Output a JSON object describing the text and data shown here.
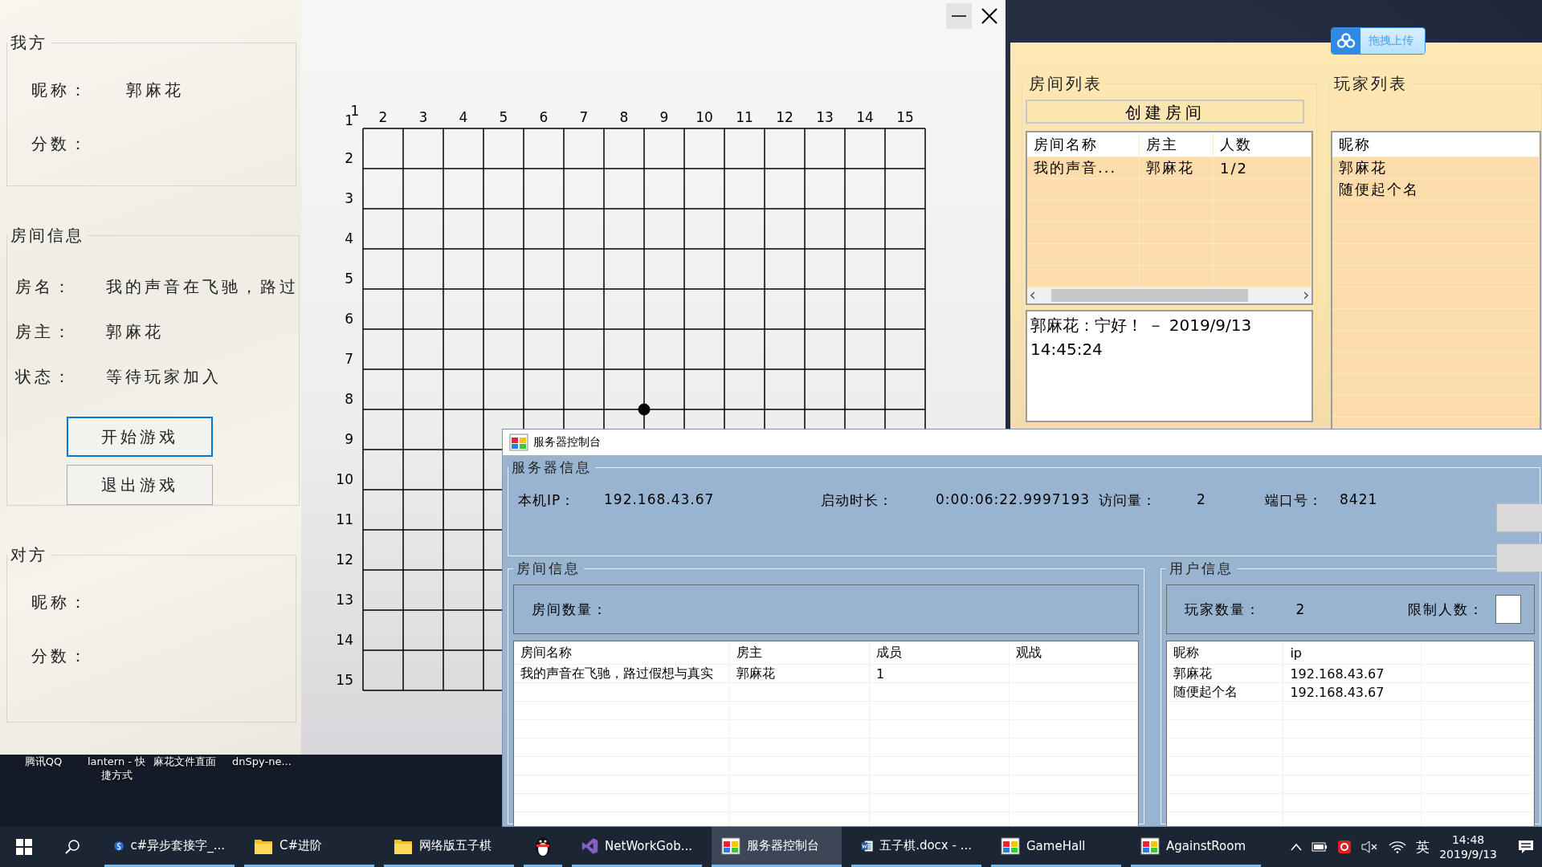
{
  "desktop_icons": [
    {
      "lines": [
        "腾讯QQ"
      ]
    },
    {
      "lines": [
        "lantern - 快",
        "捷方式"
      ]
    },
    {
      "lines": [
        "麻花文件直面"
      ]
    },
    {
      "lines": [
        "dnSpy-ne..."
      ]
    }
  ],
  "game_window": {
    "groups": [
      {
        "title": "我方",
        "fields": [
          {
            "label": "昵称：",
            "value": "郭麻花"
          },
          {
            "label": "分数："
          }
        ]
      },
      {
        "title": "房间信息",
        "fields": [
          {
            "label": "房名：",
            "value": "我的声音在飞驰，路过"
          },
          {
            "label": "房主：",
            "value": "郭麻花"
          },
          {
            "label": "状态：",
            "value": "等待玩家加入"
          }
        ],
        "buttons": [
          {
            "label": "开始游戏",
            "focused": true
          },
          {
            "label": "退出游戏",
            "focused": false
          }
        ]
      },
      {
        "title": "对方",
        "fields": [
          {
            "label": "昵称："
          },
          {
            "label": "分数："
          }
        ]
      }
    ],
    "board": {
      "column_labels": [
        "1",
        "2",
        "3",
        "4",
        "5",
        "6",
        "7",
        "8",
        "9",
        "10",
        "11",
        "12",
        "13",
        "14",
        "15"
      ],
      "rows": [
        {
          "label": "1",
          "points": [
            {
              "stone": false
            },
            {
              "stone": false
            },
            {
              "stone": false
            },
            {
              "stone": false
            },
            {
              "stone": false
            },
            {
              "stone": false
            },
            {
              "stone": false
            },
            {
              "stone": false
            },
            {
              "stone": false
            },
            {
              "stone": false
            },
            {
              "stone": false
            },
            {
              "stone": false
            },
            {
              "stone": false
            },
            {
              "stone": false
            },
            {
              "stone": false
            }
          ]
        },
        {
          "label": "2",
          "points": [
            {
              "stone": false
            },
            {
              "stone": false
            },
            {
              "stone": false
            },
            {
              "stone": false
            },
            {
              "stone": false
            },
            {
              "stone": false
            },
            {
              "stone": false
            },
            {
              "stone": false
            },
            {
              "stone": false
            },
            {
              "stone": false
            },
            {
              "stone": false
            },
            {
              "stone": false
            },
            {
              "stone": false
            },
            {
              "stone": false
            },
            {
              "stone": false
            }
          ]
        },
        {
          "label": "3",
          "points": [
            {
              "stone": false
            },
            {
              "stone": false
            },
            {
              "stone": false
            },
            {
              "stone": false
            },
            {
              "stone": false
            },
            {
              "stone": false
            },
            {
              "stone": false
            },
            {
              "stone": false
            },
            {
              "stone": false
            },
            {
              "stone": false
            },
            {
              "stone": false
            },
            {
              "stone": false
            },
            {
              "stone": false
            },
            {
              "stone": false
            },
            {
              "stone": false
            }
          ]
        },
        {
          "label": "4",
          "points": [
            {
              "stone": false
            },
            {
              "stone": false
            },
            {
              "stone": false
            },
            {
              "stone": false
            },
            {
              "stone": false
            },
            {
              "stone": false
            },
            {
              "stone": false
            },
            {
              "stone": false
            },
            {
              "stone": false
            },
            {
              "stone": false
            },
            {
              "stone": false
            },
            {
              "stone": false
            },
            {
              "stone": false
            },
            {
              "stone": false
            },
            {
              "stone": false
            }
          ]
        },
        {
          "label": "5",
          "points": [
            {
              "stone": false
            },
            {
              "stone": false
            },
            {
              "stone": false
            },
            {
              "stone": false
            },
            {
              "stone": false
            },
            {
              "stone": false
            },
            {
              "stone": false
            },
            {
              "stone": false
            },
            {
              "stone": false
            },
            {
              "stone": false
            },
            {
              "stone": false
            },
            {
              "stone": false
            },
            {
              "stone": false
            },
            {
              "stone": false
            },
            {
              "stone": false
            }
          ]
        },
        {
          "label": "6",
          "points": [
            {
              "stone": false
            },
            {
              "stone": false
            },
            {
              "stone": false
            },
            {
              "stone": false
            },
            {
              "stone": false
            },
            {
              "stone": false
            },
            {
              "stone": false
            },
            {
              "stone": false
            },
            {
              "stone": false
            },
            {
              "stone": false
            },
            {
              "stone": false
            },
            {
              "stone": false
            },
            {
              "stone": false
            },
            {
              "stone": false
            },
            {
              "stone": false
            }
          ]
        },
        {
          "label": "7",
          "points": [
            {
              "stone": false
            },
            {
              "stone": false
            },
            {
              "stone": false
            },
            {
              "stone": false
            },
            {
              "stone": false
            },
            {
              "stone": false
            },
            {
              "stone": false
            },
            {
              "stone": false
            },
            {
              "stone": false
            },
            {
              "stone": false
            },
            {
              "stone": false
            },
            {
              "stone": false
            },
            {
              "stone": false
            },
            {
              "stone": false
            },
            {
              "stone": false
            }
          ]
        },
        {
          "label": "8",
          "points": [
            {
              "stone": false
            },
            {
              "stone": false
            },
            {
              "stone": false
            },
            {
              "stone": false
            },
            {
              "stone": false
            },
            {
              "stone": false
            },
            {
              "stone": false
            },
            {
              "stone": true
            },
            {
              "stone": false
            },
            {
              "stone": false
            },
            {
              "stone": false
            },
            {
              "stone": false
            },
            {
              "stone": false
            },
            {
              "stone": false
            },
            {
              "stone": false
            }
          ]
        },
        {
          "label": "9",
          "points": [
            {
              "stone": false
            },
            {
              "stone": false
            },
            {
              "stone": false
            },
            {
              "stone": false
            }
          ]
        },
        {
          "label": "10",
          "points": [
            {
              "stone": false
            },
            {
              "stone": false
            },
            {
              "stone": false
            },
            {
              "stone": false
            }
          ]
        },
        {
          "label": "11",
          "points": [
            {
              "stone": false
            },
            {
              "stone": false
            },
            {
              "stone": false
            },
            {
              "stone": false
            }
          ]
        },
        {
          "label": "12",
          "points": [
            {
              "stone": false
            },
            {
              "stone": false
            },
            {
              "stone": false
            },
            {
              "stone": false
            }
          ]
        },
        {
          "label": "13",
          "points": [
            {
              "stone": false
            },
            {
              "stone": false
            },
            {
              "stone": false
            },
            {
              "stone": false
            }
          ]
        },
        {
          "label": "14",
          "points": [
            {
              "stone": false
            },
            {
              "stone": false
            },
            {
              "stone": false
            },
            {
              "stone": false
            }
          ]
        },
        {
          "label": "15",
          "points": [
            {
              "stone": false
            },
            {
              "stone": false
            },
            {
              "stone": false
            },
            {
              "stone": false
            }
          ]
        }
      ]
    }
  },
  "upload_widget": {
    "label": "拖拽上传"
  },
  "game_hall": {
    "room_list": {
      "title": "房间列表",
      "create_button": "创建房间",
      "columns": [
        "房间名称",
        "房主",
        "人数"
      ],
      "rows": [
        [
          "我的声音...",
          "郭麻花",
          "1/2"
        ]
      ]
    },
    "chat": "郭麻花：宁好！ － 2019/9/13 14:45:24",
    "player_list": {
      "title": "玩家列表",
      "columns": [
        "昵称"
      ],
      "rows": [
        [
          "郭麻花"
        ],
        [
          "随便起个名"
        ]
      ]
    }
  },
  "server_console": {
    "title": "服务器控制台",
    "server_info": {
      "title": "服务器信息",
      "fields": [
        {
          "label": "本机IP：",
          "value": "192.168.43.67"
        },
        {
          "label": "启动时长：",
          "value": "0:00:06:22.9997193"
        },
        {
          "label": "访问量：",
          "value": "2"
        },
        {
          "label": "端口号：",
          "value": "8421"
        }
      ]
    },
    "room_info": {
      "title": "房间信息",
      "count_label": "房间数量：",
      "columns": [
        "房间名称",
        "房主",
        "成员",
        "观战"
      ],
      "rows": [
        [
          "我的声音在飞驰，路过假想与真实",
          "郭麻花",
          "1",
          ""
        ]
      ]
    },
    "user_info": {
      "title": "用户信息",
      "count_label": "玩家数量：",
      "count": "2",
      "limit_label": "限制人数：",
      "columns": [
        "昵称",
        "ip"
      ],
      "rows": [
        [
          "郭麻花",
          "192.168.43.67"
        ],
        [
          "随便起个名",
          "192.168.43.67"
        ]
      ]
    }
  },
  "taskbar": {
    "items": [
      {
        "kind": "browser",
        "label": "c#异步套接字_...",
        "selected": false
      },
      {
        "kind": "folder",
        "label": "C#进阶",
        "selected": false
      },
      {
        "kind": "folder",
        "label": "网络版五子棋",
        "selected": false
      },
      {
        "kind": "penguin",
        "selected": false
      },
      {
        "kind": "studio",
        "label": "NetWorkGob...",
        "selected": false
      },
      {
        "kind": "app",
        "label": "服务器控制台",
        "selected": true
      },
      {
        "kind": "word",
        "label": "五子棋.docx - ...",
        "selected": false
      },
      {
        "kind": "app",
        "label": "GameHall",
        "selected": false
      },
      {
        "kind": "app",
        "label": "AgainstRoom",
        "selected": false
      }
    ],
    "ime": "英",
    "time": "14:48",
    "date": "2019/9/13"
  }
}
